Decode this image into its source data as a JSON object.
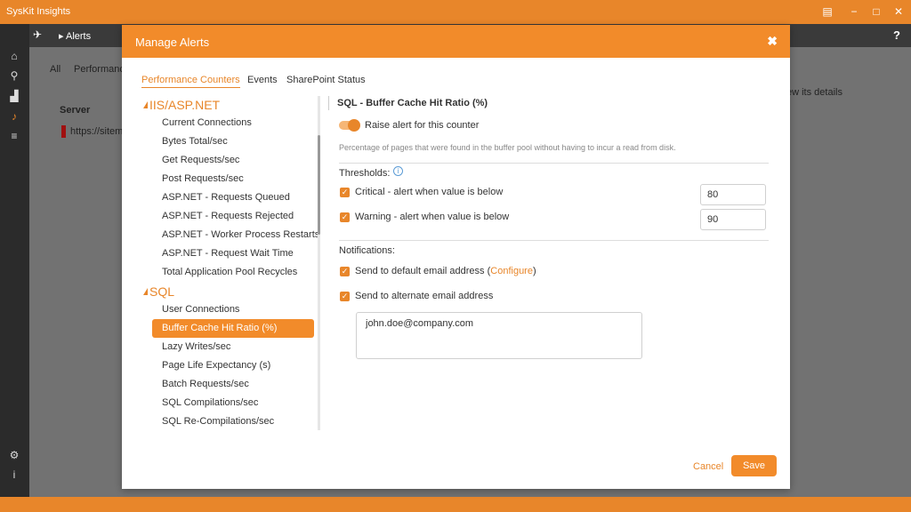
{
  "app": {
    "title": "SysKit Insights"
  },
  "window_controls": {
    "feedback": "▤",
    "minimize": "−",
    "maximize": "□",
    "close": "✕"
  },
  "breadcrumb": {
    "page": "Alerts"
  },
  "help": {
    "label": "?"
  },
  "background": {
    "filter_all": "All",
    "filter_performance": "Performance",
    "column_server": "Server",
    "row_server": "https://sitem",
    "hint": "ew its details"
  },
  "sidebar": {
    "icons": [
      "home-icon",
      "search-icon",
      "reports-icon",
      "bell-icon",
      "list-icon",
      "gear-icon",
      "info-icon"
    ]
  },
  "modal": {
    "title": "Manage Alerts",
    "close_glyph": "✖",
    "tabs": [
      "Performance Counters",
      "Events",
      "SharePoint Status"
    ],
    "tree": {
      "groups": [
        {
          "name": "IIS/ASP.NET",
          "items": [
            "Current Connections",
            "Bytes Total/sec",
            "Get Requests/sec",
            "Post Requests/sec",
            "ASP.NET - Requests Queued",
            "ASP.NET - Requests Rejected",
            "ASP.NET - Worker Process Restarts",
            "ASP.NET - Request Wait Time",
            "Total Application Pool Recycles"
          ]
        },
        {
          "name": "SQL",
          "items": [
            "User Connections",
            "Buffer Cache Hit Ratio (%)",
            "Lazy Writes/sec",
            "Page Life Expectancy (s)",
            "Batch Requests/sec",
            "SQL Compilations/sec",
            "SQL Re-Compilations/sec"
          ]
        }
      ],
      "selected": "Buffer Cache Hit Ratio (%)"
    },
    "detail": {
      "title": "SQL - Buffer Cache Hit Ratio (%)",
      "toggle_label": "Raise alert for this counter",
      "toggle_on": true,
      "description": "Percentage of pages that were found in the buffer pool without having to incur a read from disk.",
      "thresholds_label": "Thresholds:",
      "critical_label": "Critical - alert when value is below",
      "critical_value": "80",
      "warning_label": "Warning - alert when value is below",
      "warning_value": "90",
      "notifications_label": "Notifications:",
      "default_email_label": "Send to default email address (",
      "configure_link": "Configure",
      "default_email_close": ")",
      "alternate_email_label": "Send to alternate email address",
      "alternate_email_value": "john.doe@company.com"
    },
    "buttons": {
      "cancel": "Cancel",
      "save": "Save"
    }
  },
  "colors": {
    "accent": "#f28b2a",
    "accent_dark": "#e8862a",
    "sidebar": "#2b2b2b"
  }
}
